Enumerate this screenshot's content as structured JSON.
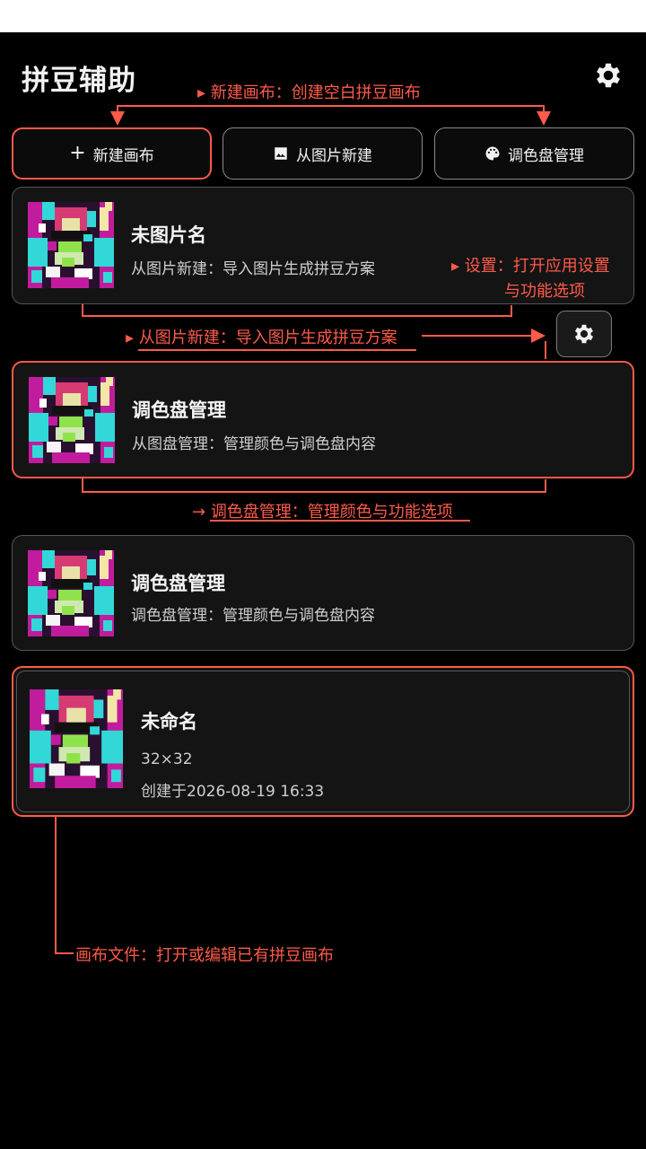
{
  "app": {
    "title": "拼豆辅助"
  },
  "toolbar": {
    "new_canvas_label": "新建画布",
    "from_image_label": "从图片新建",
    "palette_label": "调色盘管理"
  },
  "annotations": {
    "new_canvas": "新建画布：创建空白拼豆画布",
    "settings_line1": "设置：打开应用设置",
    "settings_line2": "与功能选项",
    "from_image": "从图片新建：导入图片生成拼豆方案",
    "palette": "调色盘管理：管理颜色与功能选项",
    "canvas_file": "画布文件：打开或编辑已有拼豆画布"
  },
  "cards": [
    {
      "title": "未图片名",
      "subtitle": "从图片新建：导入图片生成拼豆方案"
    },
    {
      "title": "调色盘管理",
      "subtitle": "从图盘管理：管理颜色与调色盘内容"
    },
    {
      "title": "调色盘管理",
      "subtitle": "调色盘管理：管理颜色与调色盘内容"
    },
    {
      "title": "未命名",
      "size": "32×32",
      "created": "创建于2026-08-19 16:33"
    }
  ],
  "colors": {
    "accent": "#ff5a4a",
    "background": "#000000",
    "card": "#141414"
  },
  "icons": [
    "gear-icon",
    "plus-icon",
    "image-icon",
    "palette-icon"
  ]
}
